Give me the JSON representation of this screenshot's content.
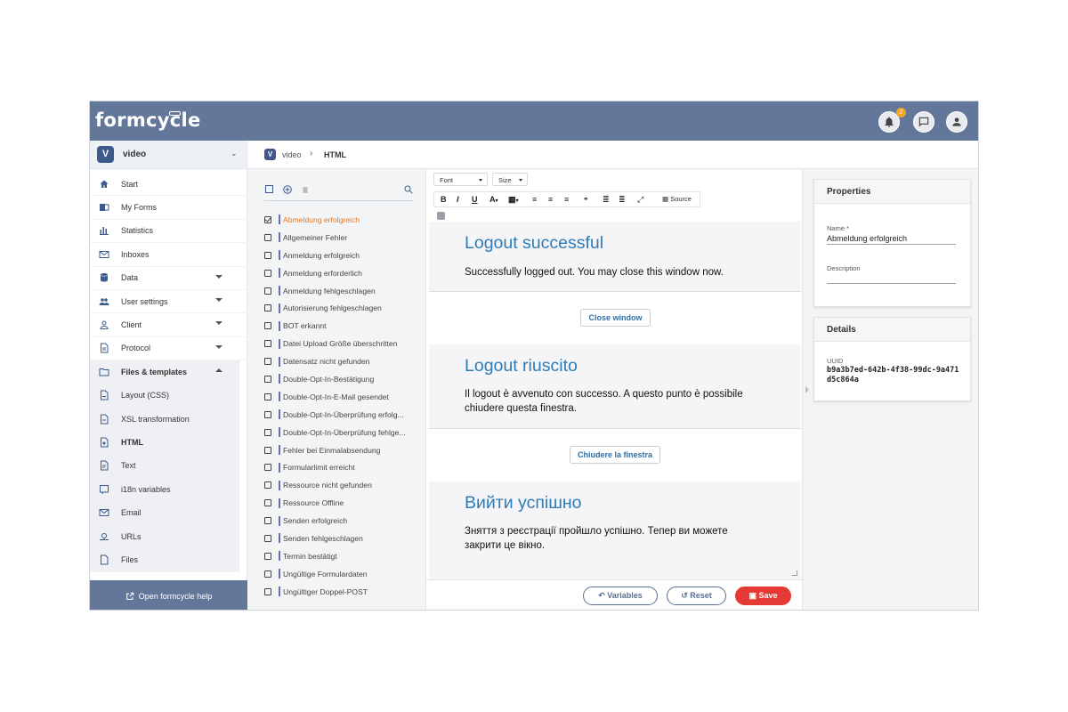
{
  "app": {
    "logo": "formcycle"
  },
  "topbar": {
    "notifications_count": "2"
  },
  "workspace": {
    "badge": "V",
    "name": "video"
  },
  "nav": {
    "items": [
      {
        "label": "Start",
        "icon": "home-icon"
      },
      {
        "label": "My Forms",
        "icon": "forms-icon"
      },
      {
        "label": "Statistics",
        "icon": "bar-chart-icon"
      },
      {
        "label": "Inboxes",
        "icon": "mail-icon"
      },
      {
        "label": "Data",
        "icon": "database-icon"
      },
      {
        "label": "User settings",
        "icon": "users-icon"
      },
      {
        "label": "Client",
        "icon": "person-icon"
      },
      {
        "label": "Protocol",
        "icon": "document-icon"
      }
    ],
    "group_label": "Files & templates",
    "sub_items": [
      {
        "label": "Layout (CSS)"
      },
      {
        "label": "XSL transformation"
      },
      {
        "label": "HTML"
      },
      {
        "label": "Text"
      },
      {
        "label": "i18n variables"
      },
      {
        "label": "Email"
      },
      {
        "label": "URLs"
      },
      {
        "label": "Files"
      }
    ],
    "help_label": "Open formcycle help"
  },
  "breadcrumb": {
    "badge": "V",
    "workspace": "video",
    "current": "HTML"
  },
  "templates": {
    "selected_index": 0,
    "items": [
      "Abmeldung erfolgreich",
      "Allgemeiner Fehler",
      "Anmeldung erfolgreich",
      "Anmeldung erforderlich",
      "Anmeldung fehlgeschlagen",
      "Autorisierung fehlgeschlagen",
      "BOT erkannt",
      "Datei Upload Größe überschritten",
      "Datensatz nicht gefunden",
      "Double-Opt-In-Bestätigung",
      "Double-Opt-In-E-Mail gesendet",
      "Double-Opt-In-Überprüfung erfolg...",
      "Double-Opt-In-Überprüfung fehlge...",
      "Fehler bei Einmalabsendung",
      "Formularlimit erreicht",
      "Ressource nicht gefunden",
      "Ressource Offline",
      "Senden erfolgreich",
      "Senden fehlgeschlagen",
      "Termin bestätigt",
      "Ungültige Formulardaten",
      "Ungültiger Doppel-POST"
    ]
  },
  "editor": {
    "font_label": "Font",
    "size_label": "Size",
    "source_label": "Source",
    "blocks": [
      {
        "title": "Logout successful",
        "text": "Successfully logged out. You may close this window now.",
        "button": "Close window"
      },
      {
        "title": "Logout riuscito",
        "text": "Il logout è avvenuto con successo. A questo punto è possibile chiudere questa finestra.",
        "button": "Chiudere la finestra"
      },
      {
        "title": "Вийти успішно",
        "text": "Зняття з реєстрації пройшло успішно. Тепер ви можете закрити це вікно."
      }
    ],
    "variables_label": "Variables",
    "reset_label": "Reset",
    "save_label": "Save"
  },
  "properties": {
    "title": "Properties",
    "name_label": "Name *",
    "name_value": "Abmeldung erfolgreich",
    "description_label": "Description",
    "description_value": ""
  },
  "details": {
    "title": "Details",
    "uuid_label": "UUID",
    "uuid_value": "b9a3b7ed-642b-4f38-99dc-9a471d5c864a"
  },
  "colors": {
    "topbar": "#63779a",
    "accent": "#3d5a8c",
    "link": "#2d7cb8",
    "selected": "#e87722",
    "save": "#e53935"
  }
}
